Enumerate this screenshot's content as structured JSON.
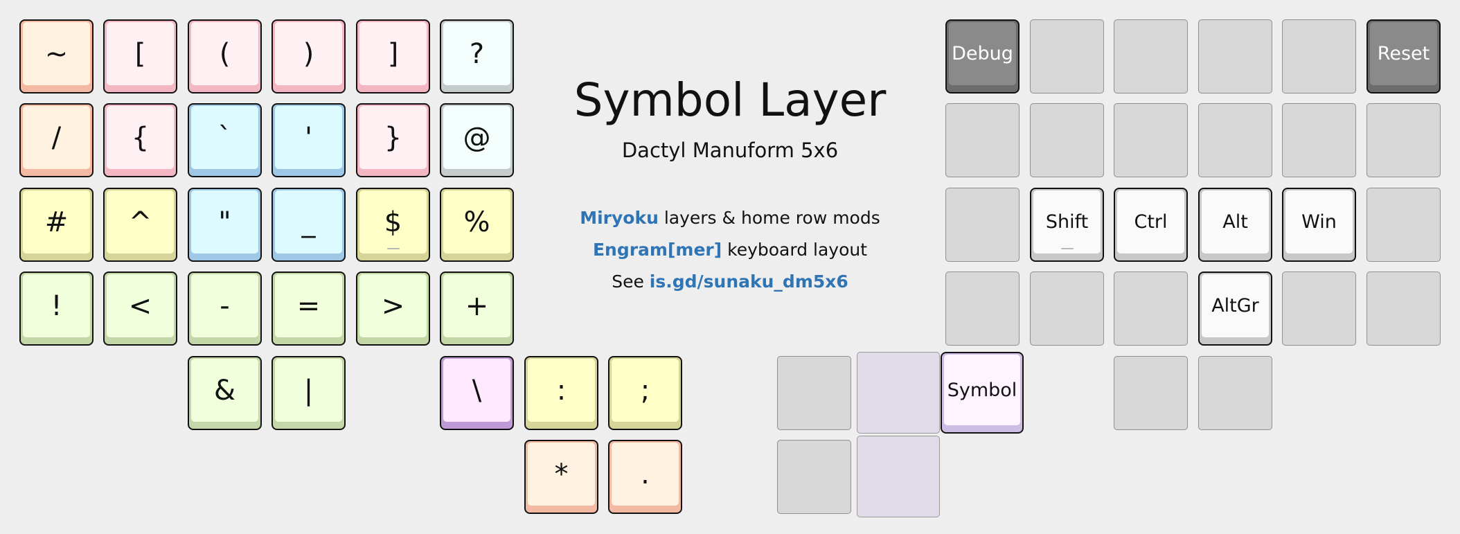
{
  "title": "Symbol Layer",
  "subtitle": "Dactyl Manuform 5x6",
  "info": {
    "line1": {
      "link": "Miryoku",
      "text": " layers & home row mods"
    },
    "line2": {
      "link": "Engram[mer]",
      "text": " keyboard layout"
    },
    "line3": {
      "text": "See ",
      "link": "is.gd/sunaku_dm5x6"
    }
  },
  "colors": {
    "peach": "#fff2e0",
    "peach_edge": "#f3b9a2",
    "pink": "#fff0f4",
    "pink_edge": "#f2b7c2",
    "mint": "#f4fffd",
    "mint_edge": "#c5cccb",
    "cyan": "#dcfaff",
    "cyan_edge": "#9fc8e6",
    "yellow": "#ffffc8",
    "yellow_edge": "#d7d49a",
    "green": "#f2ffdc",
    "green_edge": "#c4d7a8",
    "magenta": "#ffe9ff",
    "magenta_edge": "#bf9ad6",
    "white": "#fafafa",
    "white_edge": "#c8c8c8",
    "gray_dark": "#8a8a8a",
    "gray_dark_edge": "#6c6c6c",
    "lavender": "#cbbde3",
    "lavender_cap": "#fdf4ff",
    "empty": "#d7d7d7",
    "thumb_hold": "#e0dae9"
  },
  "left_keys": [
    {
      "label": "~",
      "color": "peach"
    },
    {
      "label": "[",
      "color": "pink"
    },
    {
      "label": "(",
      "color": "pink"
    },
    {
      "label": ")",
      "color": "pink"
    },
    {
      "label": "]",
      "color": "pink"
    },
    {
      "label": "?",
      "color": "mint"
    },
    {
      "label": "/",
      "color": "peach"
    },
    {
      "label": "{",
      "color": "pink"
    },
    {
      "label": "`",
      "color": "cyan"
    },
    {
      "label": "'",
      "color": "cyan"
    },
    {
      "label": "}",
      "color": "pink"
    },
    {
      "label": "@",
      "color": "mint"
    },
    {
      "label": "#",
      "color": "yellow"
    },
    {
      "label": "^",
      "color": "yellow"
    },
    {
      "label": "\"",
      "color": "cyan"
    },
    {
      "label": "_",
      "color": "cyan"
    },
    {
      "label": "$",
      "color": "yellow",
      "homing": true
    },
    {
      "label": "%",
      "color": "yellow"
    },
    {
      "label": "!",
      "color": "green"
    },
    {
      "label": "<",
      "color": "green"
    },
    {
      "label": "-",
      "color": "green"
    },
    {
      "label": "=",
      "color": "green"
    },
    {
      "label": ">",
      "color": "green"
    },
    {
      "label": "+",
      "color": "green"
    },
    {
      "label": "&",
      "color": "green"
    },
    {
      "label": "|",
      "color": "green"
    }
  ],
  "left_thumb_keys": [
    {
      "label": "\\",
      "color": "magenta"
    },
    {
      "label": ":",
      "color": "yellow"
    },
    {
      "label": ";",
      "color": "yellow"
    },
    {
      "label": "*",
      "color": "peach"
    },
    {
      "label": ".",
      "color": "peach"
    }
  ],
  "right_keys": [
    {
      "label": "Debug",
      "color": "gray_dark"
    },
    {
      "label": "Reset",
      "color": "gray_dark"
    },
    {
      "label": "Shift",
      "color": "white",
      "homing": true
    },
    {
      "label": "Ctrl",
      "color": "white"
    },
    {
      "label": "Alt",
      "color": "white"
    },
    {
      "label": "Win",
      "color": "white"
    },
    {
      "label": "AltGr",
      "color": "white"
    }
  ],
  "right_thumb_keys": [
    {
      "label": "Symbol",
      "color": "lavender"
    }
  ]
}
